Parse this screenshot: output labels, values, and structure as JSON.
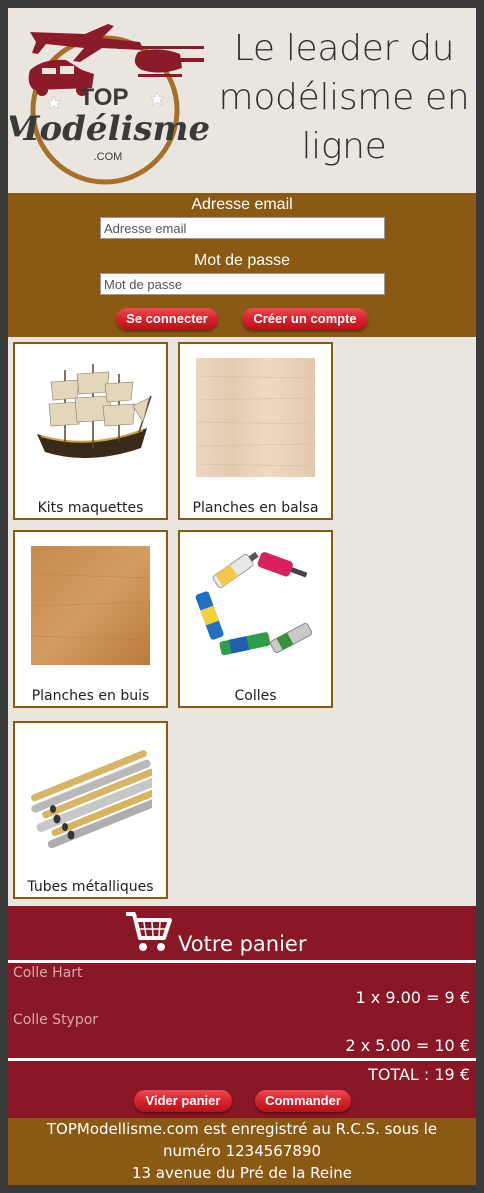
{
  "header": {
    "logo": {
      "top_text": "TOP",
      "main_text": "Modélisme",
      "sub_text": ".COM"
    },
    "tagline": "Le leader du modélisme en ligne"
  },
  "login": {
    "email_label": "Adresse email",
    "email_placeholder": "Adresse email",
    "password_label": "Mot de passe",
    "password_placeholder": "Mot de passe",
    "login_button": "Se connecter",
    "register_button": "Créer un compte"
  },
  "products": [
    {
      "label": "Kits maquettes",
      "image": "ship-model-image"
    },
    {
      "label": "Planches en balsa",
      "image": "balsa-wood-image"
    },
    {
      "label": "Planches en buis",
      "image": "boxwood-image"
    },
    {
      "label": "Colles",
      "image": "glue-tubes-image"
    },
    {
      "label": "Tubes métalliques",
      "image": "metal-tubes-image"
    }
  ],
  "cart": {
    "icon": "shopping-cart-icon",
    "title": "Votre panier",
    "items": [
      {
        "name": "Colle Hart",
        "line": "1 x 9.00 = 9 €"
      },
      {
        "name": "Colle Stypor",
        "line": "2 x 5.00 = 10 €"
      }
    ],
    "total": "TOTAL : 19 €",
    "empty_button": "Vider panier",
    "order_button": "Commander"
  },
  "footer": {
    "line1": "TOPModellisme.com est enregistré au R.C.S. sous le numéro 1234567890",
    "line2": "13 avenue du Pré de la Reine"
  },
  "colors": {
    "brown": "#8a5a14",
    "burgundy": "#8a1725",
    "background": "#ebe5df",
    "button_red": "#d8252e"
  }
}
